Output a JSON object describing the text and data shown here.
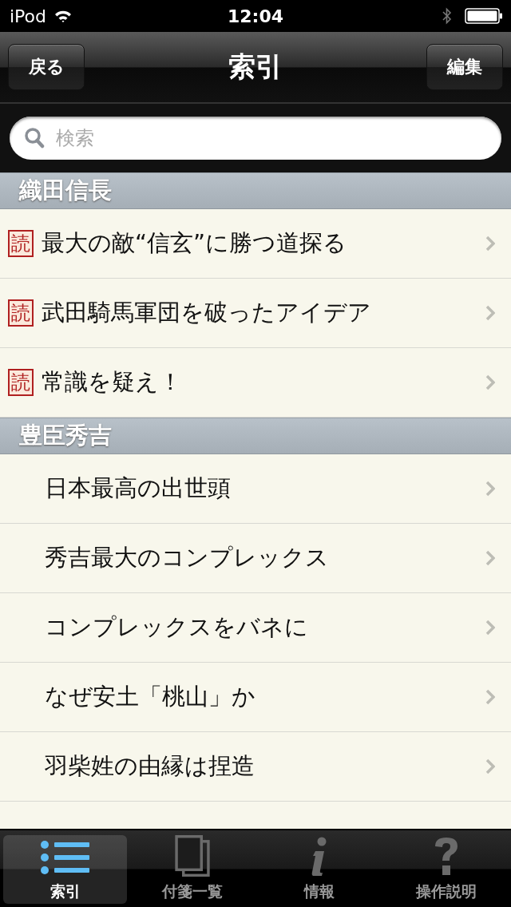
{
  "status_bar": {
    "carrier": "iPod",
    "time": "12:04"
  },
  "nav": {
    "back": "戻る",
    "title": "索引",
    "edit": "編集"
  },
  "search": {
    "placeholder": "検索"
  },
  "sections": [
    {
      "title": "織田信長",
      "rows": [
        {
          "badge": "読",
          "label": "最大の敵“信玄”に勝つ道探る"
        },
        {
          "badge": "読",
          "label": "武田騎馬軍団を破ったアイデア"
        },
        {
          "badge": "読",
          "label": "常識を疑え！"
        }
      ]
    },
    {
      "title": "豊臣秀吉",
      "rows": [
        {
          "label": "日本最高の出世頭"
        },
        {
          "label": "秀吉最大のコンプレックス"
        },
        {
          "label": "コンプレックスをバネに"
        },
        {
          "label": "なぜ安土「桃山」か"
        },
        {
          "label": "羽柴姓の由縁は捏造"
        }
      ]
    }
  ],
  "tabs": [
    {
      "kind": "list",
      "label": "索引",
      "selected": true
    },
    {
      "kind": "notes",
      "label": "付箋一覧",
      "selected": false
    },
    {
      "kind": "info",
      "label": "情報",
      "selected": false
    },
    {
      "kind": "help",
      "label": "操作説明",
      "selected": false
    }
  ]
}
